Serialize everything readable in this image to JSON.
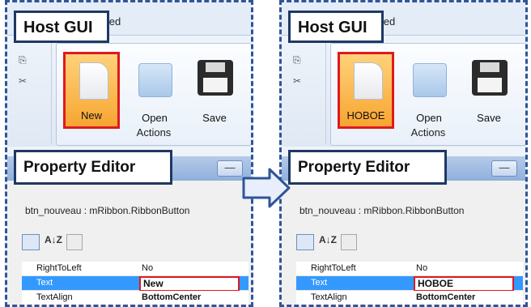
{
  "left": {
    "callout_host": "Host GUI",
    "tab_partial": "nced",
    "buttons": {
      "new": "New",
      "open": "Open",
      "save": "Save"
    },
    "group_label": "Actions",
    "callout_editor": "Property Editor",
    "minimize": "—",
    "object_name": "btn_nouveau : mRibbon.RibbonButton",
    "properties": [
      {
        "key": "RightToLeft",
        "value": "No"
      },
      {
        "key": "Text",
        "value": "New"
      },
      {
        "key": "TextAlign",
        "value": "BottomCenter"
      }
    ]
  },
  "right": {
    "callout_host": "Host GUI",
    "tab_partial": "nced",
    "buttons": {
      "new": "HOBOE",
      "open": "Open",
      "save": "Save"
    },
    "group_label": "Actions",
    "callout_editor": "Property Editor",
    "minimize": "—",
    "object_name": "btn_nouveau : mRibbon.RibbonButton",
    "properties": [
      {
        "key": "RightToLeft",
        "value": "No"
      },
      {
        "key": "Text",
        "value": "HOBOE"
      },
      {
        "key": "TextAlign",
        "value": "BottomCenter"
      }
    ]
  },
  "toolbar_sort_glyph": "A↓Z",
  "colors": {
    "border": "#2f5597",
    "highlight": "#e0191f",
    "selection": "#3399ff",
    "arrow_fill": "#e8eefa"
  }
}
